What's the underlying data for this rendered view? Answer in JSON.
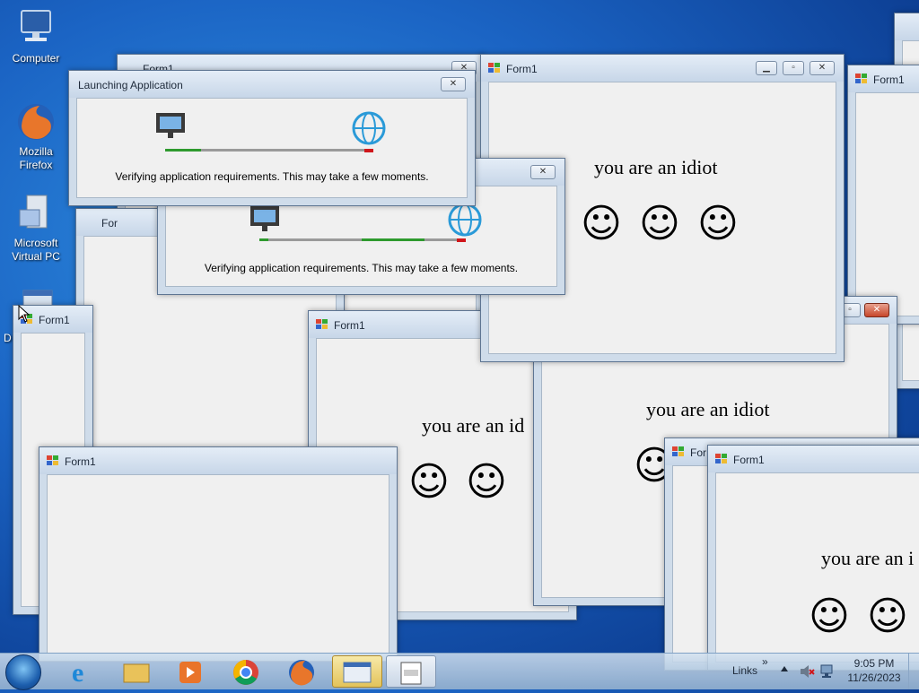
{
  "desktop": {
    "icons": [
      {
        "label": "Computer",
        "icon": "computer-icon"
      },
      {
        "label": "Mozilla Firefox",
        "icon": "firefox-icon"
      },
      {
        "label": "Microsoft Virtual PC",
        "icon": "virtual-pc-icon"
      },
      {
        "label": "D",
        "icon": "shortcut-icon"
      }
    ]
  },
  "windows": {
    "form_title": "Form1",
    "form_title_partial": "For",
    "message": "you are an idiot",
    "message_partial_1": "you are an id",
    "message_partial_2": "you are an i",
    "smiley": "☺"
  },
  "launch": {
    "title": "Launching Application",
    "status": "Verifying application requirements. This may take a few moments."
  },
  "taskbar": {
    "start": "start-orb-icon",
    "pinned": [
      "internet-explorer-icon",
      "file-explorer-icon",
      "media-player-icon",
      "chrome-icon",
      "firefox-icon",
      "app-window-icon",
      "form-app-icon"
    ],
    "links_label": "Links",
    "links_chevron": "»",
    "time": "9:05 PM",
    "date": "11/26/2023"
  },
  "colors": {
    "progress_green": "#2e9a2e",
    "progress_red": "#d0161b",
    "progress_gray": "#9a9a9a",
    "taskbar_active": "#e3c35a"
  }
}
